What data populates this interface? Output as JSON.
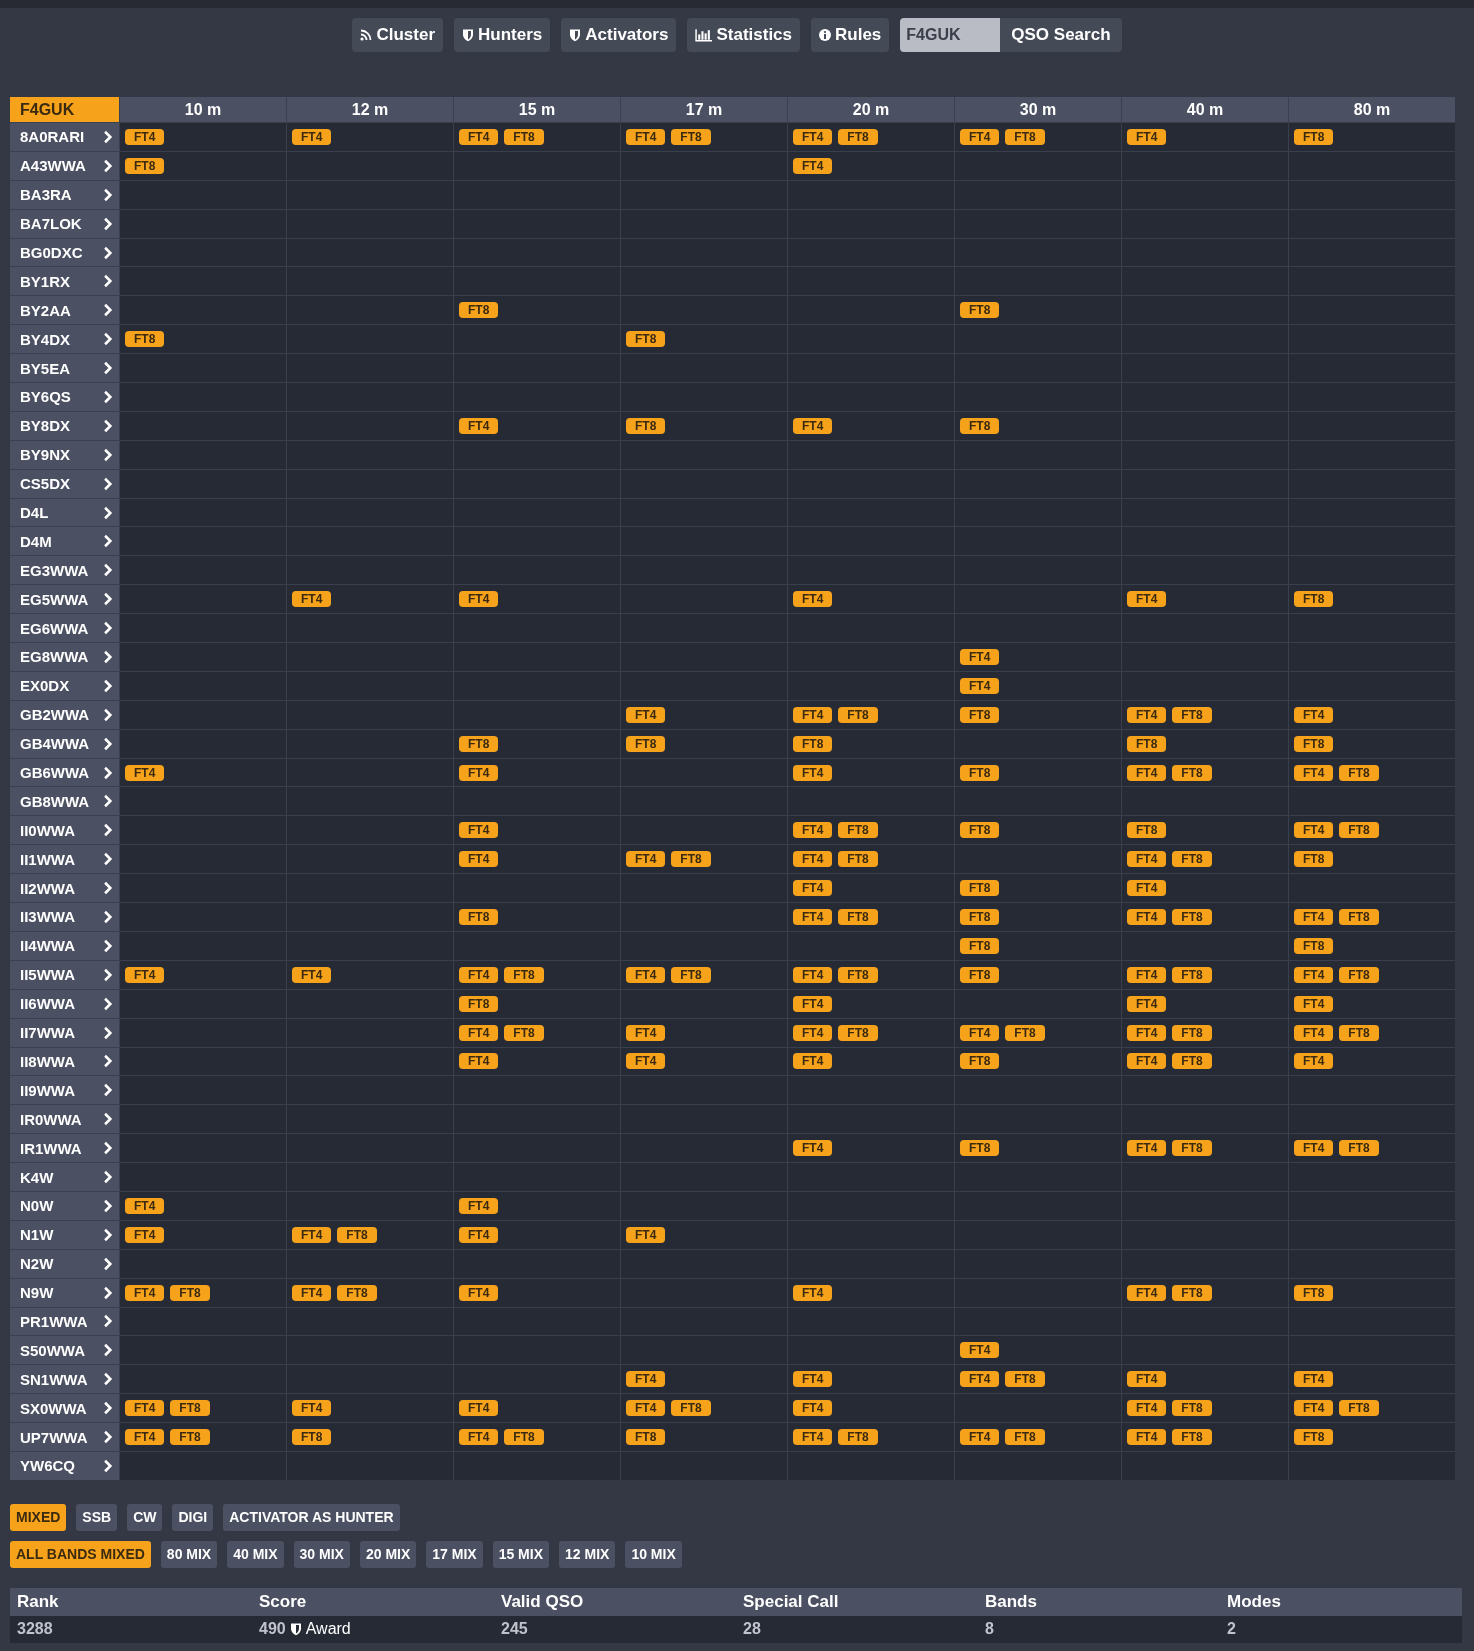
{
  "nav": {
    "buttons": [
      "Cluster",
      "Hunters",
      "Activators",
      "Statistics",
      "Rules"
    ],
    "search": {
      "value": "F4GUK"
    },
    "search_button": "QSO Search"
  },
  "grid": {
    "corner": "F4GUK",
    "bands": [
      "10 m",
      "12 m",
      "15 m",
      "17 m",
      "20 m",
      "30 m",
      "40 m",
      "80 m"
    ],
    "rows": [
      {
        "call": "8A0RARI",
        "cells": [
          [
            "FT4"
          ],
          [
            "FT4"
          ],
          [
            "FT4",
            "FT8"
          ],
          [
            "FT4",
            "FT8"
          ],
          [
            "FT4",
            "FT8"
          ],
          [
            "FT4",
            "FT8"
          ],
          [
            "FT4"
          ],
          [
            "FT8"
          ]
        ]
      },
      {
        "call": "A43WWA",
        "cells": [
          [
            "FT8"
          ],
          [],
          [],
          [],
          [
            "FT4"
          ],
          [],
          [],
          []
        ]
      },
      {
        "call": "BA3RA",
        "cells": [
          [],
          [],
          [],
          [],
          [],
          [],
          [],
          []
        ]
      },
      {
        "call": "BA7LOK",
        "cells": [
          [],
          [],
          [],
          [],
          [],
          [],
          [],
          []
        ]
      },
      {
        "call": "BG0DXC",
        "cells": [
          [],
          [],
          [],
          [],
          [],
          [],
          [],
          []
        ]
      },
      {
        "call": "BY1RX",
        "cells": [
          [],
          [],
          [],
          [],
          [],
          [],
          [],
          []
        ]
      },
      {
        "call": "BY2AA",
        "cells": [
          [],
          [],
          [
            "FT8"
          ],
          [],
          [],
          [
            "FT8"
          ],
          [],
          []
        ]
      },
      {
        "call": "BY4DX",
        "cells": [
          [
            "FT8"
          ],
          [],
          [],
          [
            "FT8"
          ],
          [],
          [],
          [],
          []
        ]
      },
      {
        "call": "BY5EA",
        "cells": [
          [],
          [],
          [],
          [],
          [],
          [],
          [],
          []
        ]
      },
      {
        "call": "BY6QS",
        "cells": [
          [],
          [],
          [],
          [],
          [],
          [],
          [],
          []
        ]
      },
      {
        "call": "BY8DX",
        "cells": [
          [],
          [],
          [
            "FT4"
          ],
          [
            "FT8"
          ],
          [
            "FT4"
          ],
          [
            "FT8"
          ],
          [],
          []
        ]
      },
      {
        "call": "BY9NX",
        "cells": [
          [],
          [],
          [],
          [],
          [],
          [],
          [],
          []
        ]
      },
      {
        "call": "CS5DX",
        "cells": [
          [],
          [],
          [],
          [],
          [],
          [],
          [],
          []
        ]
      },
      {
        "call": "D4L",
        "cells": [
          [],
          [],
          [],
          [],
          [],
          [],
          [],
          []
        ]
      },
      {
        "call": "D4M",
        "cells": [
          [],
          [],
          [],
          [],
          [],
          [],
          [],
          []
        ]
      },
      {
        "call": "EG3WWA",
        "cells": [
          [],
          [],
          [],
          [],
          [],
          [],
          [],
          []
        ]
      },
      {
        "call": "EG5WWA",
        "cells": [
          [],
          [
            "FT4"
          ],
          [
            "FT4"
          ],
          [],
          [
            "FT4"
          ],
          [],
          [
            "FT4"
          ],
          [
            "FT8"
          ]
        ]
      },
      {
        "call": "EG6WWA",
        "cells": [
          [],
          [],
          [],
          [],
          [],
          [],
          [],
          []
        ]
      },
      {
        "call": "EG8WWA",
        "cells": [
          [],
          [],
          [],
          [],
          [],
          [
            "FT4"
          ],
          [],
          []
        ]
      },
      {
        "call": "EX0DX",
        "cells": [
          [],
          [],
          [],
          [],
          [],
          [
            "FT4"
          ],
          [],
          []
        ]
      },
      {
        "call": "GB2WWA",
        "cells": [
          [],
          [],
          [],
          [
            "FT4"
          ],
          [
            "FT4",
            "FT8"
          ],
          [
            "FT8"
          ],
          [
            "FT4",
            "FT8"
          ],
          [
            "FT4"
          ]
        ]
      },
      {
        "call": "GB4WWA",
        "cells": [
          [],
          [],
          [
            "FT8"
          ],
          [
            "FT8"
          ],
          [
            "FT8"
          ],
          [],
          [
            "FT8"
          ],
          [
            "FT8"
          ]
        ]
      },
      {
        "call": "GB6WWA",
        "cells": [
          [
            "FT4"
          ],
          [],
          [
            "FT4"
          ],
          [],
          [
            "FT4"
          ],
          [
            "FT8"
          ],
          [
            "FT4",
            "FT8"
          ],
          [
            "FT4",
            "FT8"
          ]
        ]
      },
      {
        "call": "GB8WWA",
        "cells": [
          [],
          [],
          [],
          [],
          [],
          [],
          [],
          []
        ]
      },
      {
        "call": "II0WWA",
        "cells": [
          [],
          [],
          [
            "FT4"
          ],
          [],
          [
            "FT4",
            "FT8"
          ],
          [
            "FT8"
          ],
          [
            "FT8"
          ],
          [
            "FT4",
            "FT8"
          ]
        ]
      },
      {
        "call": "II1WWA",
        "cells": [
          [],
          [],
          [
            "FT4"
          ],
          [
            "FT4",
            "FT8"
          ],
          [
            "FT4",
            "FT8"
          ],
          [],
          [
            "FT4",
            "FT8"
          ],
          [
            "FT8"
          ]
        ]
      },
      {
        "call": "II2WWA",
        "cells": [
          [],
          [],
          [],
          [],
          [
            "FT4"
          ],
          [
            "FT8"
          ],
          [
            "FT4"
          ],
          []
        ]
      },
      {
        "call": "II3WWA",
        "cells": [
          [],
          [],
          [
            "FT8"
          ],
          [],
          [
            "FT4",
            "FT8"
          ],
          [
            "FT8"
          ],
          [
            "FT4",
            "FT8"
          ],
          [
            "FT4",
            "FT8"
          ]
        ]
      },
      {
        "call": "II4WWA",
        "cells": [
          [],
          [],
          [],
          [],
          [],
          [
            "FT8"
          ],
          [],
          [
            "FT8"
          ]
        ]
      },
      {
        "call": "II5WWA",
        "cells": [
          [
            "FT4"
          ],
          [
            "FT4"
          ],
          [
            "FT4",
            "FT8"
          ],
          [
            "FT4",
            "FT8"
          ],
          [
            "FT4",
            "FT8"
          ],
          [
            "FT8"
          ],
          [
            "FT4",
            "FT8"
          ],
          [
            "FT4",
            "FT8"
          ]
        ]
      },
      {
        "call": "II6WWA",
        "cells": [
          [],
          [],
          [
            "FT8"
          ],
          [],
          [
            "FT4"
          ],
          [],
          [
            "FT4"
          ],
          [
            "FT4"
          ]
        ]
      },
      {
        "call": "II7WWA",
        "cells": [
          [],
          [],
          [
            "FT4",
            "FT8"
          ],
          [
            "FT4"
          ],
          [
            "FT4",
            "FT8"
          ],
          [
            "FT4",
            "FT8"
          ],
          [
            "FT4",
            "FT8"
          ],
          [
            "FT4",
            "FT8"
          ]
        ]
      },
      {
        "call": "II8WWA",
        "cells": [
          [],
          [],
          [
            "FT4"
          ],
          [
            "FT4"
          ],
          [
            "FT4"
          ],
          [
            "FT8"
          ],
          [
            "FT4",
            "FT8"
          ],
          [
            "FT4"
          ]
        ]
      },
      {
        "call": "II9WWA",
        "cells": [
          [],
          [],
          [],
          [],
          [],
          [],
          [],
          []
        ]
      },
      {
        "call": "IR0WWA",
        "cells": [
          [],
          [],
          [],
          [],
          [],
          [],
          [],
          []
        ]
      },
      {
        "call": "IR1WWA",
        "cells": [
          [],
          [],
          [],
          [],
          [
            "FT4"
          ],
          [
            "FT8"
          ],
          [
            "FT4",
            "FT8"
          ],
          [
            "FT4",
            "FT8"
          ]
        ]
      },
      {
        "call": "K4W",
        "cells": [
          [],
          [],
          [],
          [],
          [],
          [],
          [],
          []
        ]
      },
      {
        "call": "N0W",
        "cells": [
          [
            "FT4"
          ],
          [],
          [
            "FT4"
          ],
          [],
          [],
          [],
          [],
          []
        ]
      },
      {
        "call": "N1W",
        "cells": [
          [
            "FT4"
          ],
          [
            "FT4",
            "FT8"
          ],
          [
            "FT4"
          ],
          [
            "FT4"
          ],
          [],
          [],
          [],
          []
        ]
      },
      {
        "call": "N2W",
        "cells": [
          [],
          [],
          [],
          [],
          [],
          [],
          [],
          []
        ]
      },
      {
        "call": "N9W",
        "cells": [
          [
            "FT4",
            "FT8"
          ],
          [
            "FT4",
            "FT8"
          ],
          [
            "FT4"
          ],
          [],
          [
            "FT4"
          ],
          [],
          [
            "FT4",
            "FT8"
          ],
          [
            "FT8"
          ]
        ]
      },
      {
        "call": "PR1WWA",
        "cells": [
          [],
          [],
          [],
          [],
          [],
          [],
          [],
          []
        ]
      },
      {
        "call": "S50WWA",
        "cells": [
          [],
          [],
          [],
          [],
          [],
          [
            "FT4"
          ],
          [],
          []
        ]
      },
      {
        "call": "SN1WWA",
        "cells": [
          [],
          [],
          [],
          [
            "FT4"
          ],
          [
            "FT4"
          ],
          [
            "FT4",
            "FT8"
          ],
          [
            "FT4"
          ],
          [
            "FT4"
          ]
        ]
      },
      {
        "call": "SX0WWA",
        "cells": [
          [
            "FT4",
            "FT8"
          ],
          [
            "FT4"
          ],
          [
            "FT4"
          ],
          [
            "FT4",
            "FT8"
          ],
          [
            "FT4"
          ],
          [],
          [
            "FT4",
            "FT8"
          ],
          [
            "FT4",
            "FT8"
          ]
        ]
      },
      {
        "call": "UP7WWA",
        "cells": [
          [
            "FT4",
            "FT8"
          ],
          [
            "FT8"
          ],
          [
            "FT4",
            "FT8"
          ],
          [
            "FT8"
          ],
          [
            "FT4",
            "FT8"
          ],
          [
            "FT4",
            "FT8"
          ],
          [
            "FT4",
            "FT8"
          ],
          [
            "FT8"
          ]
        ]
      },
      {
        "call": "YW6CQ",
        "cells": [
          [],
          [],
          [],
          [],
          [],
          [],
          [],
          []
        ]
      }
    ]
  },
  "mode_filters": [
    {
      "label": "MIXED",
      "selected": true
    },
    {
      "label": "SSB",
      "selected": false
    },
    {
      "label": "CW",
      "selected": false
    },
    {
      "label": "DIGI",
      "selected": false
    },
    {
      "label": "ACTIVATOR AS HUNTER",
      "selected": false
    }
  ],
  "band_filters": [
    {
      "label": "ALL BANDS MIXED",
      "selected": true
    },
    {
      "label": "80 MIX",
      "selected": false
    },
    {
      "label": "40 MIX",
      "selected": false
    },
    {
      "label": "30 MIX",
      "selected": false
    },
    {
      "label": "20 MIX",
      "selected": false
    },
    {
      "label": "17 MIX",
      "selected": false
    },
    {
      "label": "15 MIX",
      "selected": false
    },
    {
      "label": "12 MIX",
      "selected": false
    },
    {
      "label": "10 MIX",
      "selected": false
    }
  ],
  "summary": {
    "columns": [
      "Rank",
      "Score",
      "Valid QSO",
      "Special Call",
      "Bands",
      "Modes"
    ],
    "rank": "3288",
    "score": "490",
    "award": "Award",
    "valid_qso": "245",
    "special_call": "28",
    "bands": "8",
    "modes": "2"
  }
}
